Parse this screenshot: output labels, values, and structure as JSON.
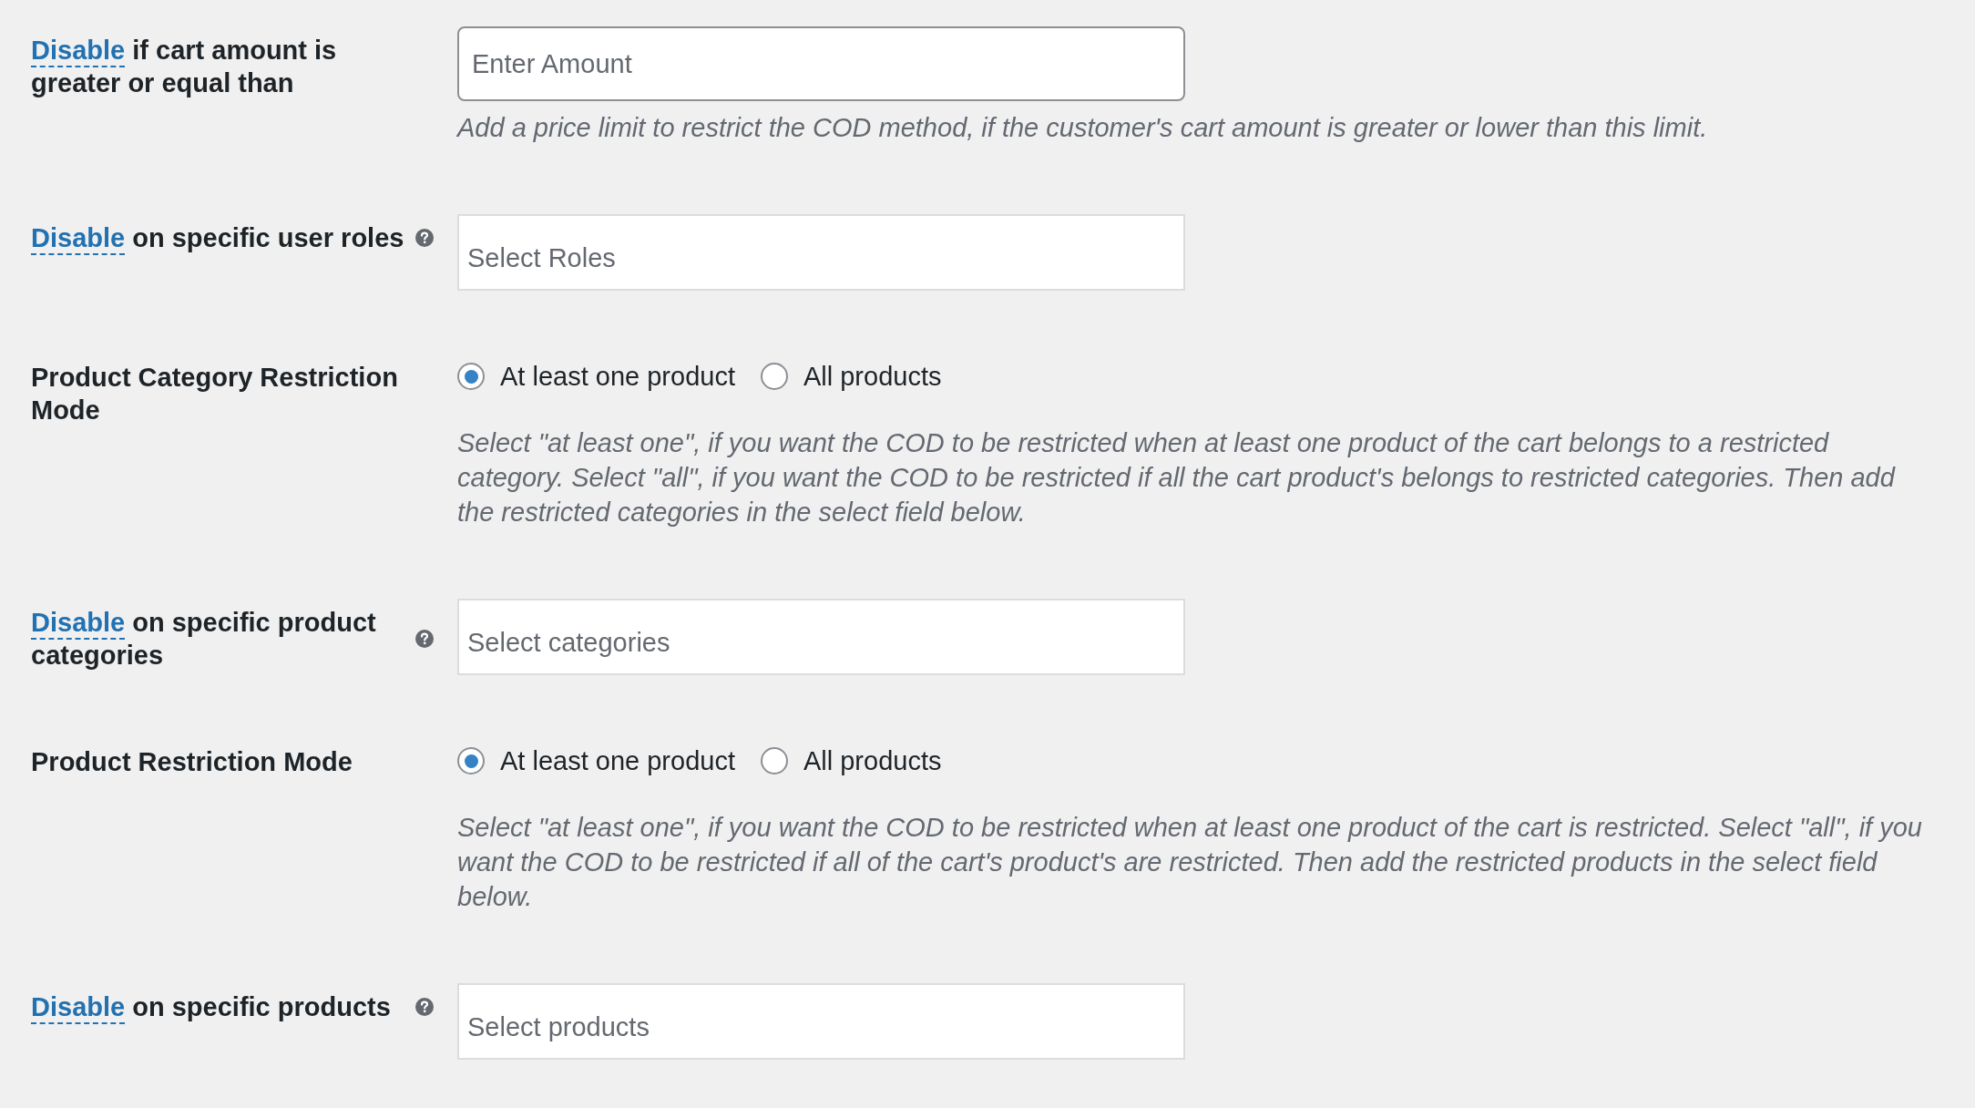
{
  "settings": [
    {
      "kind": "input",
      "label_link": "Disable",
      "label": "if cart amount is greater or equal than",
      "help_icon": false,
      "placeholder": "Enter Amount",
      "description": "Add a price limit to restrict the COD method, if the customer's cart amount is greater or lower than this limit."
    },
    {
      "kind": "select",
      "label_link": "Disable",
      "label": "on specific user roles",
      "help_icon": true,
      "placeholder": "Select Roles"
    },
    {
      "kind": "radio",
      "label": "Product Category Restriction Mode",
      "help_icon": false,
      "options": [
        {
          "label": "At least one product",
          "selected": true
        },
        {
          "label": "All products",
          "selected": false
        }
      ],
      "description": "Select \"at least one\", if you want the COD to be restricted when at least one product of the cart belongs to a restricted category. Select \"all\", if you want the COD to be restricted if all the cart product's belongs to restricted categories. Then add the restricted categories in the select field below."
    },
    {
      "kind": "select",
      "label_link": "Disable",
      "label": "on specific product categories",
      "help_icon": true,
      "placeholder": "Select categories"
    },
    {
      "kind": "radio",
      "label": "Product Restriction Mode",
      "help_icon": false,
      "options": [
        {
          "label": "At least one product",
          "selected": true
        },
        {
          "label": "All products",
          "selected": false
        }
      ],
      "description": "Select \"at least one\", if you want the COD to be restricted when at least one product of the cart is restricted. Select \"all\", if you want the COD to be restricted if all of the cart's product's are restricted. Then add the restricted products in the select field below."
    },
    {
      "kind": "select",
      "label_link": "Disable",
      "label": "on specific products",
      "help_icon": true,
      "placeholder": "Select products"
    }
  ]
}
